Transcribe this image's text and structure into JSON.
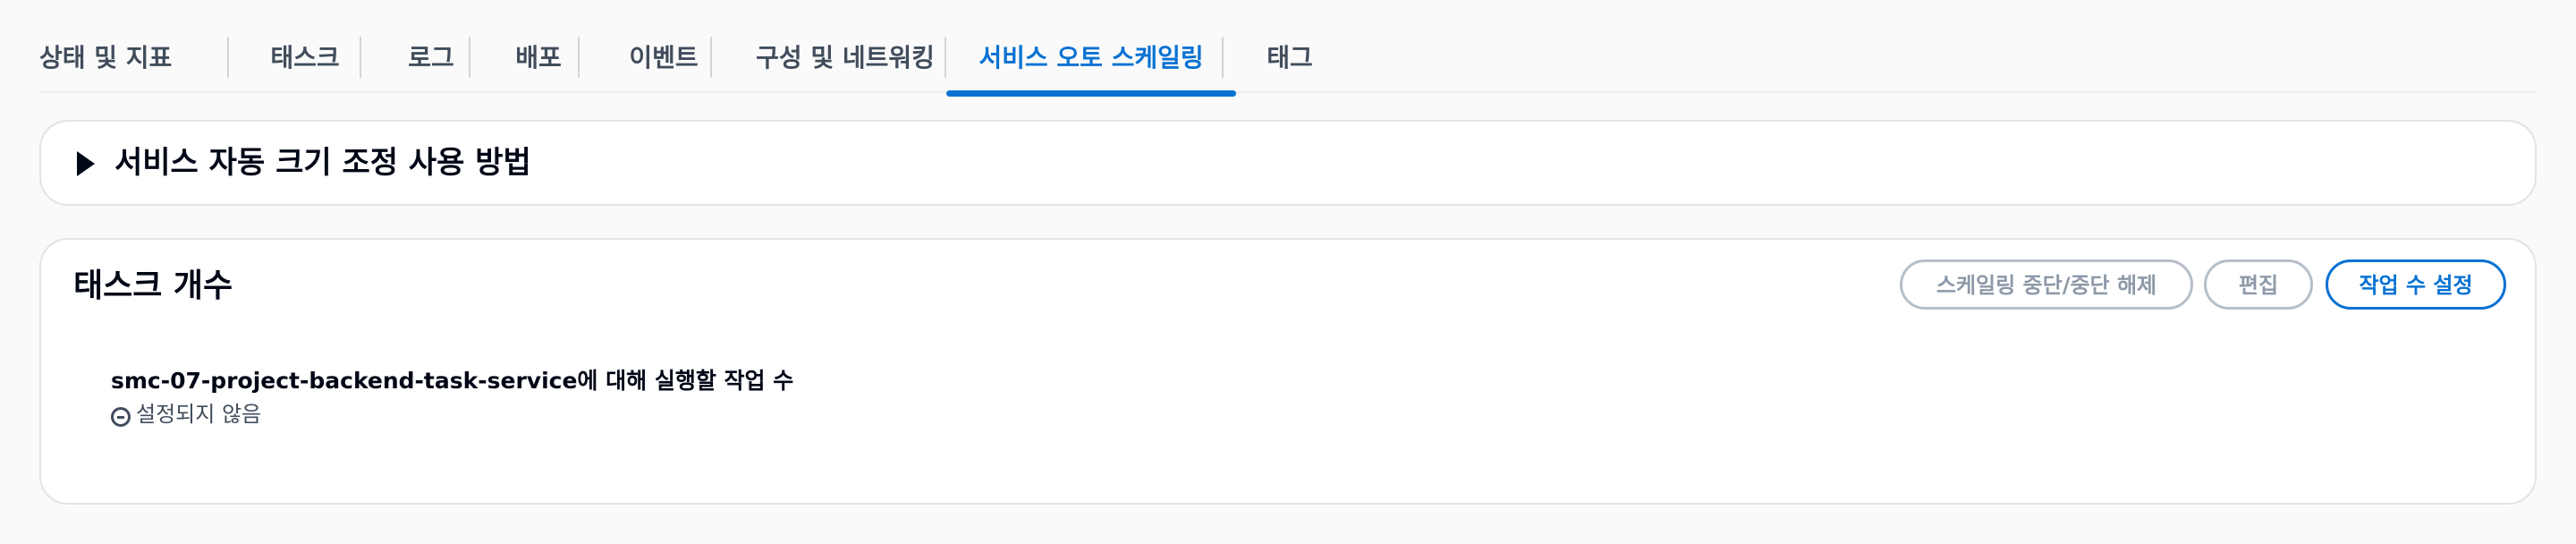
{
  "tabs": [
    {
      "label": "상태 및 지표",
      "active": false
    },
    {
      "label": "태스크",
      "active": false
    },
    {
      "label": "로그",
      "active": false
    },
    {
      "label": "배포",
      "active": false
    },
    {
      "label": "이벤트",
      "active": false
    },
    {
      "label": "구성 및 네트워킹",
      "active": false
    },
    {
      "label": "서비스 오토 스케일링",
      "active": true
    },
    {
      "label": "태그",
      "active": false
    }
  ],
  "help_section": {
    "title": "서비스 자동 크기 조정 사용 방법",
    "icon": "caret-right-icon"
  },
  "task_count": {
    "title": "태스크 개수",
    "buttons": {
      "suspend": "스케일링 중단/중단 해제",
      "edit": "편집",
      "set_tasks": "작업 수 설정"
    },
    "field_label": "smc-07-project-backend-task-service에 대해 실행할 작업 수",
    "field_value": "설정되지 않음",
    "field_value_icon": "minus-circle-icon"
  },
  "colors": {
    "accent": "#0972d3",
    "text": "#000716",
    "muted": "#414d5c",
    "disabled": "#8d99a8"
  }
}
